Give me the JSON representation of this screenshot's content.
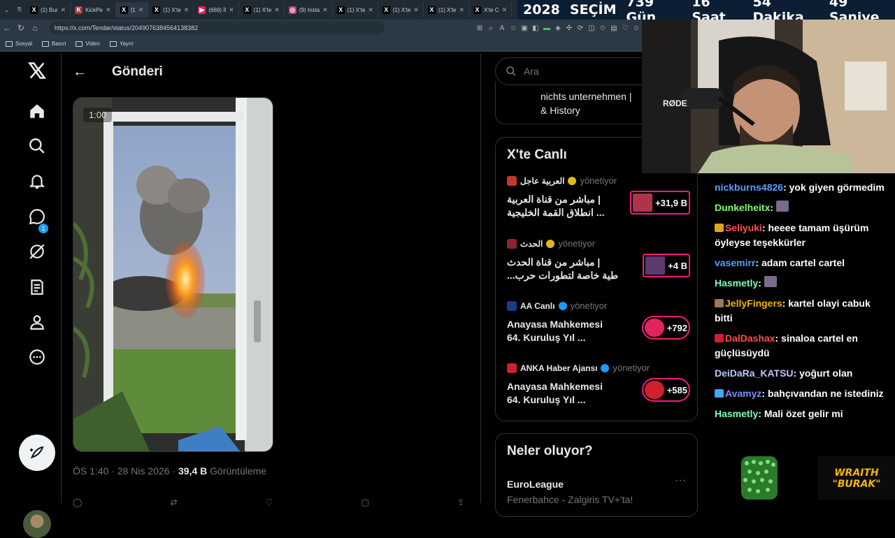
{
  "browser": {
    "tabs": [
      {
        "label": "(1) Bur",
        "icon": "X",
        "color": "#000000",
        "active": false
      },
      {
        "label": "KickPe",
        "icon": "K",
        "color": "#9b3a3a",
        "active": false
      },
      {
        "label": "(1",
        "icon": "X",
        "color": "#000000",
        "active": true
      },
      {
        "label": "(1) X'te",
        "icon": "X",
        "color": "#000000",
        "active": false
      },
      {
        "label": "(669) İl",
        "icon": "▶",
        "color": "#e0245e",
        "active": false
      },
      {
        "label": "(1) X'te",
        "icon": "X",
        "color": "#000000",
        "active": false
      },
      {
        "label": "(9) Insta",
        "icon": "◎",
        "color": "#c13584",
        "active": false
      },
      {
        "label": "(1) X'te",
        "icon": "X",
        "color": "#000000",
        "active": false
      },
      {
        "label": "(1) X'te",
        "icon": "X",
        "color": "#000000",
        "active": false
      },
      {
        "label": "(1) X'te",
        "icon": "X",
        "color": "#000000",
        "active": false
      },
      {
        "label": "X'te C",
        "icon": "X",
        "color": "#000000",
        "active": false
      }
    ],
    "url": "https://x.com/Tendar/status/2049076384564138382",
    "bookmarks": [
      "Sosyal",
      "Basın",
      "Video",
      "Yayın"
    ]
  },
  "countdown": {
    "year": "2028",
    "label": "SEÇİM",
    "days": "739 Gün",
    "hours": "16 Saat",
    "minutes": "54 Dakika",
    "seconds": "49 Saniye"
  },
  "nav": {
    "notifications_badge": "1"
  },
  "post": {
    "title": "Gönderi",
    "video_time": "1:00",
    "time": "ÖS 1:40",
    "date": "28 Nis 2026",
    "views": "39,4 B",
    "views_label": "Görüntüleme"
  },
  "search": {
    "placeholder": "Ara"
  },
  "previous_card": {
    "line1": "nichts unternehmen |",
    "line2": "& History"
  },
  "live": {
    "title": "X'te Canlı",
    "items": [
      {
        "name": "العربية عاجل",
        "role": "yönetiyor",
        "line1": "مباشر من قناة العربية |",
        "line2": "انطلاق القمة الخليجية ...",
        "count": "+31,9 B",
        "logo_color": "#c0392b",
        "thumb_color": "#b0334a",
        "round": false
      },
      {
        "name": "الحدث",
        "role": "yönetiyor",
        "line1": "مباشر من قناة الحدث |",
        "line2": "...طية خاصة لتطورات حرب",
        "count": "+4 B",
        "logo_color": "#8e2430",
        "thumb_color": "#5b3a6e",
        "round": false
      },
      {
        "name": "AA Canlı",
        "role": "yönetiyor",
        "line1": "Anayasa Mahkemesi",
        "line2": "64. Kuruluş Yıl ...",
        "count": "+792",
        "logo_color": "#1d3b8c",
        "thumb_color": "#e0245e",
        "round": true
      },
      {
        "name": "ANKA Haber Ajansı",
        "role": "yönetiyor",
        "line1": "Anayasa Mahkemesi",
        "line2": "64. Kuruluş Yıl ...",
        "count": "+585",
        "logo_color": "#d0202e",
        "thumb_color": "#d0202e",
        "round": true
      }
    ]
  },
  "whats_happening": {
    "title": "Neler oluyor?",
    "topic": "EuroLeague",
    "more": "···",
    "subtitle": "Fenerbahce - Zalgiris TV+'ta!"
  },
  "chat": {
    "messages": [
      {
        "user": "nickburns4826",
        "text": "yok giyen görmedim",
        "color": "#5b9cff",
        "badge": ""
      },
      {
        "user": "Dunkelheitx",
        "text": "",
        "color": "#7dff6b",
        "badge": "",
        "emote": true
      },
      {
        "user": "Seliyuki",
        "text": "heeee tamam üşürüm öyleyse teşekkürler",
        "color": "#ff4d4d",
        "badge": "#e6a21a"
      },
      {
        "user": "vasemirr",
        "text": "adam cartel cartel",
        "color": "#5b9cff",
        "badge": ""
      },
      {
        "user": "Hasmetly",
        "text": "",
        "color": "#7dffb5",
        "badge": "",
        "emote": true
      },
      {
        "user": "JellyFingers",
        "text": "kartel olayi cabuk bitti",
        "color": "#f4b400",
        "badge": "#a0785a"
      },
      {
        "user": "DalDashax",
        "text": "sinaloa cartel en güçlüsüydü",
        "color": "#ff4d4d",
        "badge": "#d0202e"
      },
      {
        "user": "DeiDaRa_KATSU",
        "text": "yoğurt olan",
        "color": "#b9c7ff",
        "badge": ""
      },
      {
        "user": "Avamyz",
        "text": "bahçıvandan ne istediniz",
        "color": "#7a8bff",
        "badge": "#3fa9f5"
      },
      {
        "user": "Hasmetly",
        "text": "Mali özet gelir mi",
        "color": "#7dffb5",
        "badge": ""
      }
    ]
  },
  "overlay": {
    "brand_line1": "WRAITH",
    "brand_line2": "\"BURAK\"",
    "mic_label": "RØDE"
  }
}
